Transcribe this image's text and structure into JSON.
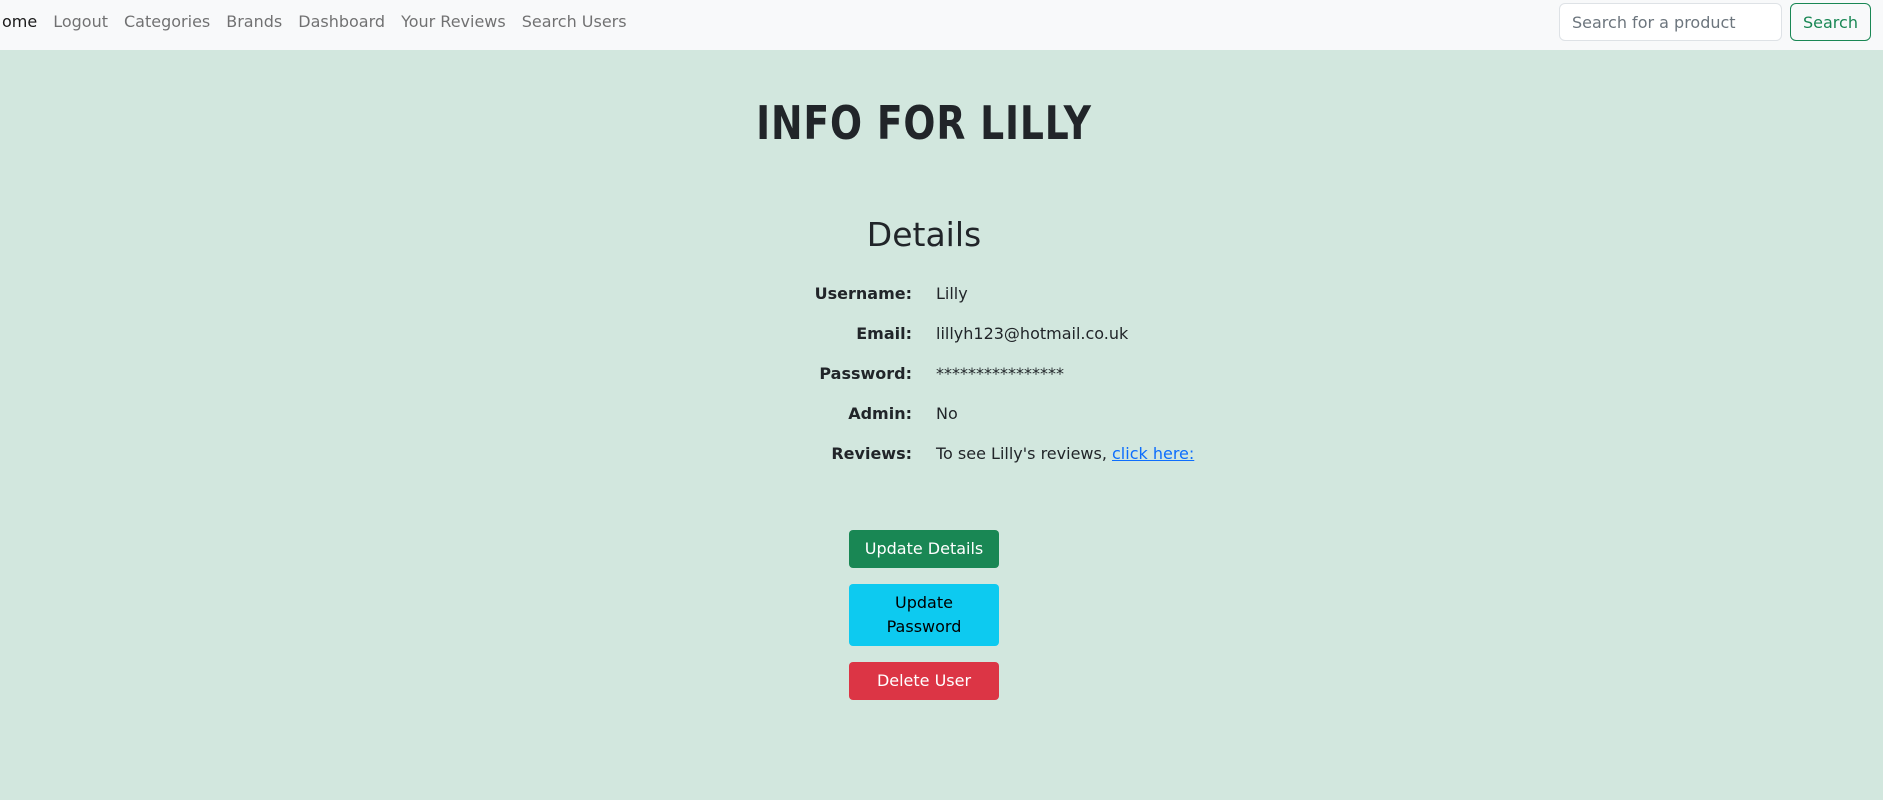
{
  "navbar": {
    "items": [
      {
        "label": "ome"
      },
      {
        "label": "Logout"
      },
      {
        "label": "Categories"
      },
      {
        "label": "Brands"
      },
      {
        "label": "Dashboard"
      },
      {
        "label": "Your Reviews"
      },
      {
        "label": "Search Users"
      }
    ],
    "search": {
      "placeholder": "Search for a product",
      "value": "",
      "button_label": "Search"
    }
  },
  "main": {
    "title": "Info for Lilly",
    "details_heading": "Details",
    "details": [
      {
        "label": "Username:",
        "value": "Lilly"
      },
      {
        "label": "Email:",
        "value": "lillyh123@hotmail.co.uk"
      },
      {
        "label": "Password:",
        "value": "****************"
      },
      {
        "label": "Admin:",
        "value": "No"
      },
      {
        "label": "Reviews:",
        "value": "To see Lilly's reviews, ",
        "link": "click here:"
      }
    ],
    "buttons": {
      "update_details": "Update Details",
      "update_password": "Update Password",
      "delete_user": "Delete User"
    }
  },
  "colors": {
    "background": "#d2e7de",
    "navbar_bg": "#f8f9fa",
    "success": "#198754",
    "info": "#0dcaf0",
    "danger": "#dc3545",
    "link": "#0d6efd"
  }
}
